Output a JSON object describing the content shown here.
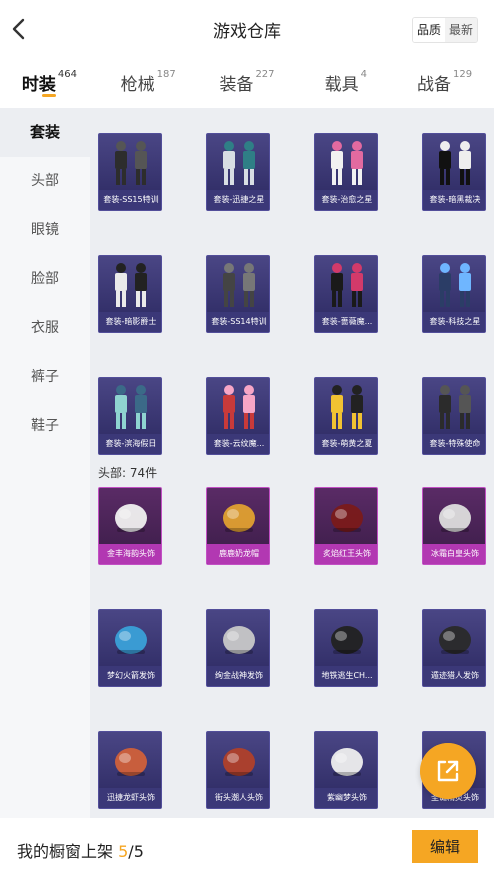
{
  "header": {
    "title": "游戏仓库",
    "toggle": [
      "品质",
      "最新"
    ]
  },
  "tabs": [
    {
      "label": "时装",
      "count": "464"
    },
    {
      "label": "枪械",
      "count": "187"
    },
    {
      "label": "装备",
      "count": "227"
    },
    {
      "label": "载具",
      "count": "4"
    },
    {
      "label": "战备",
      "count": "129"
    }
  ],
  "sidebar": [
    "套装",
    "头部",
    "眼镜",
    "脸部",
    "衣服",
    "裤子",
    "鞋子"
  ],
  "suits": [
    "套装-SS15特训",
    "套装-迅捷之星",
    "套装-治愈之星",
    "套装-暗黑裁决",
    "套装-暗影爵士",
    "套装-SS14特训",
    "套装-蔷薇魔...",
    "套装-科技之星",
    "套装-滨海假日",
    "套装-云纹魔...",
    "套装-萌黄之夏",
    "套装-特殊使命"
  ],
  "head_section": {
    "label": "头部: 74件"
  },
  "heads": [
    "金丰海韵头饰",
    "鹿鹿奶龙帽",
    "炙焰红王头饰",
    "冰霜白皇头饰",
    "梦幻火箭发饰",
    "绚金战神发饰",
    "地铁逃生CH...",
    "遁迹猎人发饰",
    "迅捷龙虾头饰",
    "街头潮人头饰",
    "紫幽梦头饰",
    "圣诞精灵头饰"
  ],
  "footer": {
    "label": "我的橱窗上架",
    "shelved": "5",
    "separator": "/",
    "capacity": "5",
    "edit_label": "编辑"
  },
  "colors": {
    "accent": "#f5a623",
    "card_purple": "#3b3878",
    "card_pink": "#b238b2"
  },
  "icons": {
    "back": "chevron-left-icon",
    "share": "external-link-icon"
  }
}
